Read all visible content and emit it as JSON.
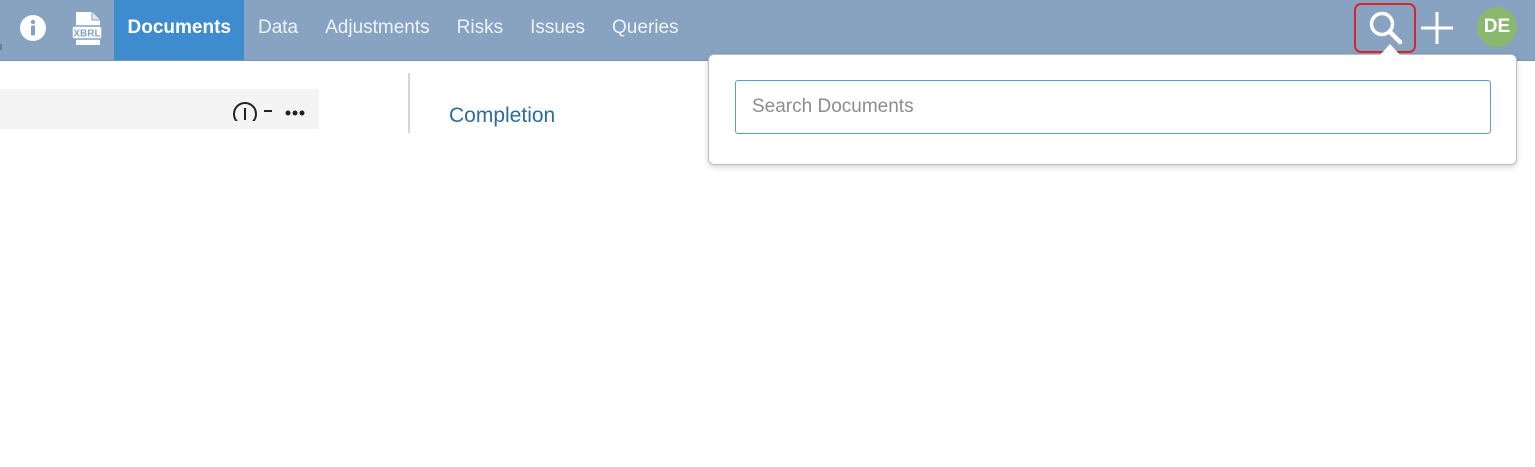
{
  "topbar": {
    "background": "#87a3c1",
    "active_color": "#3e8ccd",
    "info_icon": "info-icon",
    "xbrl_icon": {
      "name": "xbrl-file-icon",
      "label": "XBRL"
    },
    "nav": [
      {
        "label": "Documents",
        "active": true
      },
      {
        "label": "Data",
        "active": false
      },
      {
        "label": "Adjustments",
        "active": false
      },
      {
        "label": "Risks",
        "active": false
      },
      {
        "label": "Issues",
        "active": false
      },
      {
        "label": "Queries",
        "active": false
      }
    ],
    "search_icon": "search-icon",
    "add_icon": "plus-icon",
    "avatar": {
      "initials": "DE",
      "color": "#8ab86e"
    }
  },
  "content": {
    "section_heading": "Completion"
  },
  "search_popover": {
    "placeholder": "Search Documents",
    "value": ""
  }
}
